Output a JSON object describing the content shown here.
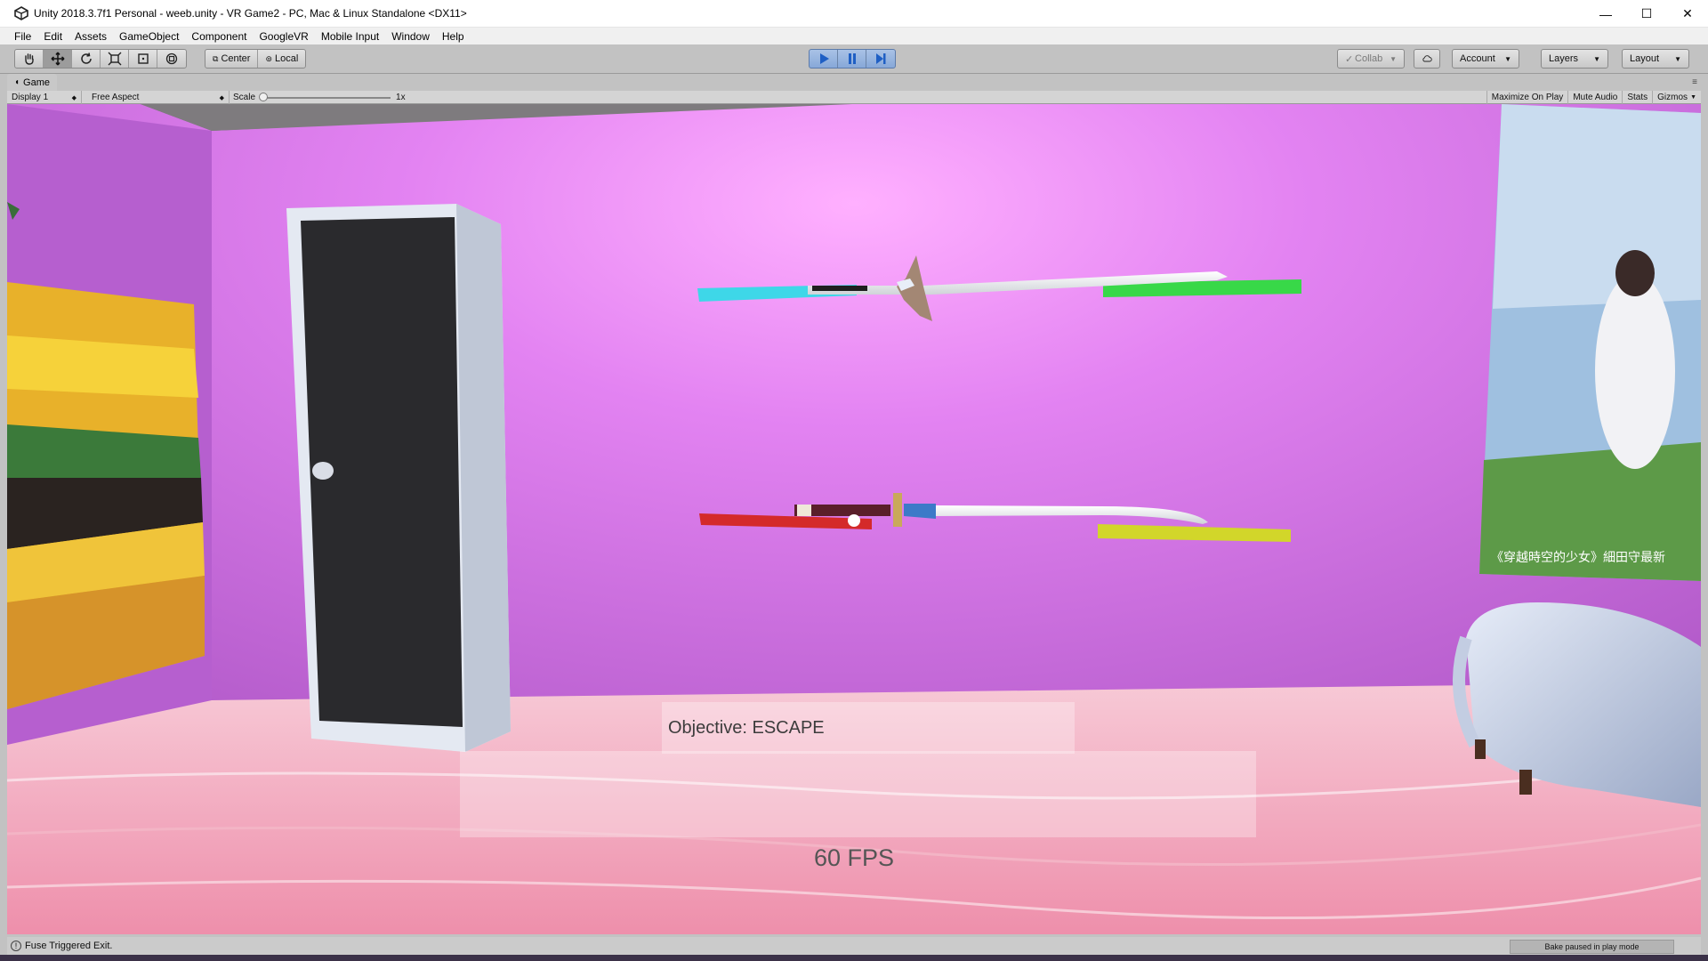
{
  "window": {
    "title": "Unity 2018.3.7f1 Personal - weeb.unity - VR Game2 - PC, Mac & Linux Standalone <DX11>",
    "controls": [
      "—",
      "☐",
      "✕"
    ]
  },
  "menu": [
    "File",
    "Edit",
    "Assets",
    "GameObject",
    "Component",
    "GoogleVR",
    "Mobile Input",
    "Window",
    "Help"
  ],
  "toolbar": {
    "pivot_center": "Center",
    "pivot_local": "Local",
    "collab": "Collab",
    "account": "Account",
    "layers": "Layers",
    "layout": "Layout"
  },
  "game_tab": {
    "label": "Game"
  },
  "game_toolbar": {
    "display": "Display 1",
    "aspect": "Free Aspect",
    "scale_label": "Scale",
    "scale_value": "1x",
    "maximize": "Maximize On Play",
    "mute": "Mute Audio",
    "stats": "Stats",
    "gizmos": "Gizmos"
  },
  "hud": {
    "objective": "Objective: ESCAPE",
    "fps": "60 FPS"
  },
  "poster": {
    "caption": "《穿越時空的少女》細田守最新"
  },
  "status": {
    "message": "Fuse Triggered Exit.",
    "bake": "Bake paused in play mode"
  },
  "colors": {
    "wall": "#c874e0",
    "floor": "#f0a0b8",
    "play_blue": "#2a6cd6"
  }
}
